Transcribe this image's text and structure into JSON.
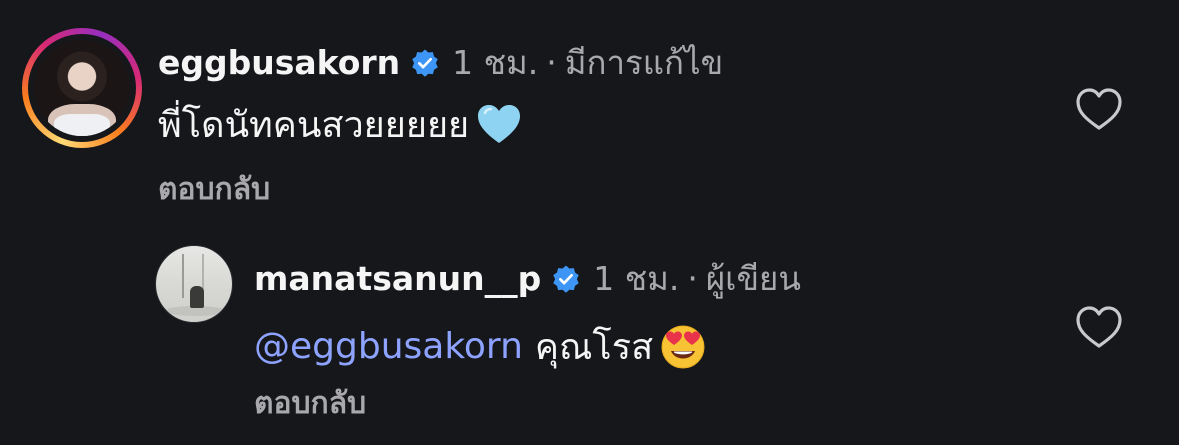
{
  "comments": [
    {
      "username": "eggbusakorn",
      "time": "1 ชม.",
      "separator": "·",
      "status": "มีการแก้ไข",
      "text": "พี่โดนัทคนสวยยยยย",
      "emoji_icon": "light-blue-heart-icon",
      "reply_label": "ตอบกลับ",
      "avatar_icon": "story-ring-avatar"
    },
    {
      "username": "manatsanun__p",
      "time": "1 ชม.",
      "separator": "·",
      "status": "ผู้เขียน",
      "mention": "@eggbusakorn",
      "text": "คุณโรส",
      "emoji_icon": "heart-eyes-emoji-icon",
      "reply_label": "ตอบกลับ",
      "avatar_icon": "avatar"
    }
  ],
  "colors": {
    "background": "#15171b",
    "text": "#f5f5f5",
    "muted": "#a8a8ad",
    "mention": "#8ea3ff",
    "verified": "#3d96f5"
  }
}
